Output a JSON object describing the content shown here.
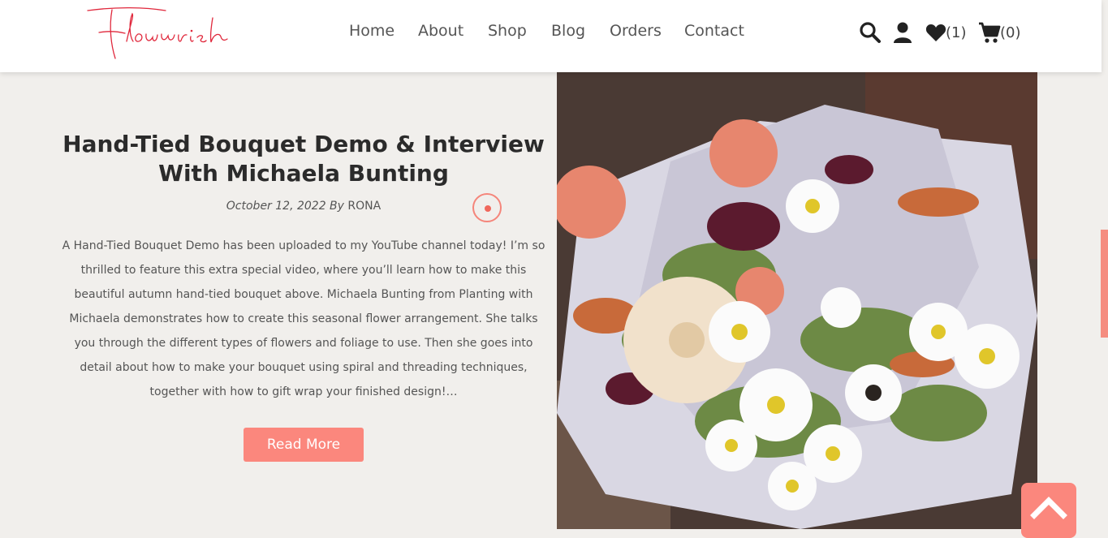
{
  "brand": {
    "logo_text": "Flourish",
    "accent": "#fb877d",
    "logo_color": "#e0283c"
  },
  "nav": {
    "items": [
      "Home",
      "About",
      "Shop",
      "Blog",
      "Orders",
      "Contact"
    ]
  },
  "header_icons": {
    "search": "search-icon",
    "account": "user-icon",
    "wishlist": "heart-icon",
    "wishlist_count": "(1)",
    "cart": "cart-icon",
    "cart_count": "(0)"
  },
  "post": {
    "title": "Hand-Tied Bouquet Demo & Interview With Michaela Bunting",
    "date_by": "October 12, 2022 By",
    "author": "RONA",
    "excerpt": "A Hand-Tied Bouquet Demo has been uploaded to my YouTube channel today! I’m so thrilled to feature this extra special video, where you’ll learn how to make this beautiful autumn hand-tied bouquet above. Michaela Bunting from Planting with Michaela demonstrates how to create this seasonal flower arrangement. She talks you through the different types of flowers and foliage to use. Then she goes into detail about how to make your bouquet using spiral and threading techniques, together with how to gift wrap your finished design!…",
    "read_more": "Read More"
  },
  "back_to_top": "chevron-up-icon"
}
